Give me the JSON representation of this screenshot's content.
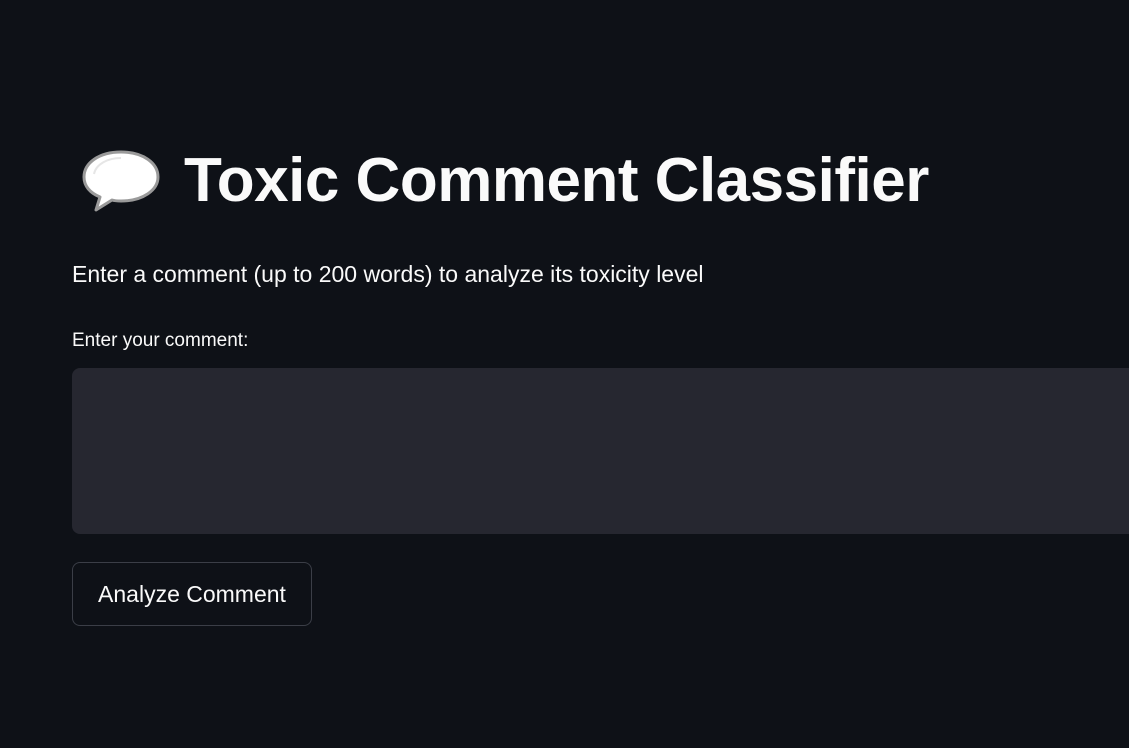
{
  "header": {
    "icon": "speech-bubble-icon",
    "title": "Toxic Comment Classifier"
  },
  "description": "Enter a comment (up to 200 words) to analyze its toxicity level",
  "comment_field": {
    "label": "Enter your comment:",
    "value": "",
    "placeholder": ""
  },
  "actions": {
    "analyze_label": "Analyze Comment"
  },
  "colors": {
    "background": "#0e1117",
    "input_background": "#262730",
    "text": "#fafafa",
    "button_border": "#3b3e47"
  }
}
